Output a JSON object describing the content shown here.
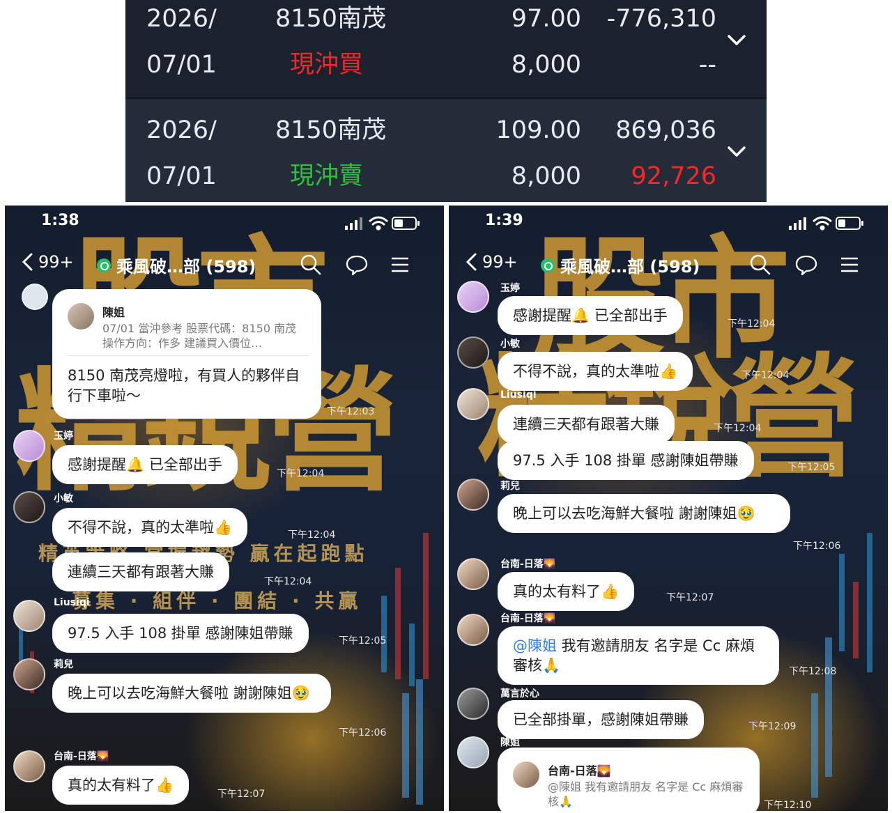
{
  "trades": [
    {
      "date_line1": "2026/",
      "date_line2": "07/01",
      "stock": "8150南茂",
      "action": "現沖買",
      "price": "97.00",
      "quantity": "8,000",
      "amount": "-776,310",
      "pl": "--"
    },
    {
      "date_line1": "2026/",
      "date_line2": "07/01",
      "stock": "8150南茂",
      "action": "現沖賣",
      "price": "109.00",
      "quantity": "8,000",
      "amount": "869,036",
      "pl": "92,726"
    }
  ],
  "colors": {
    "buy": "#ec2a2a",
    "sell": "#2fbf3c",
    "profit": "#ff2525",
    "panel_bg": "#1b222e"
  },
  "left_phone": {
    "status_time": "1:38",
    "back_count": "99+",
    "chat_title": "乘風破…部 (598)",
    "bg_title": "股市精銳營",
    "bg_motto_1": "精英策略  掌握趨勢  贏在起跑點",
    "bg_motto_2": "募集 · 組伴 · 團結 · 共贏",
    "reply_msg": {
      "quoted_name": "陳姐",
      "quoted_text": "07/01 當沖參考 股票代碼：8150 南茂 操作方向：作多 建議買入價位…",
      "body": "8150 南茂亮燈啦，有買人的夥伴自行下車啦～",
      "time": "下午12:03"
    },
    "messages": [
      {
        "sender": "玉婷",
        "text": "感謝提醒🔔 已全部出手",
        "time": "下午12:04"
      },
      {
        "sender": "小敏",
        "text": "不得不說，真的太準啦👍",
        "time": "下午12:04"
      },
      {
        "sender": "",
        "text": "連續三天都有跟著大賺",
        "time": "下午12:04"
      },
      {
        "sender": "Liusiqi",
        "text": "97.5 入手 108 掛單 感謝陳姐帶賺",
        "time": "下午12:05"
      },
      {
        "sender": "莉兒",
        "text": "晚上可以去吃海鮮大餐啦 謝謝陳姐🥹",
        "time": "下午12:06"
      },
      {
        "sender": "台南-日落🌄",
        "text": "真的太有料了👍",
        "time": "下午12:07"
      }
    ]
  },
  "right_phone": {
    "status_time": "1:39",
    "back_count": "99+",
    "chat_title": "乘風破…部 (598)",
    "messages": [
      {
        "sender": "玉婷",
        "text": "感謝提醒🔔 已全部出手",
        "time": "下午12:04"
      },
      {
        "sender": "小敏",
        "text": "不得不說，真的太準啦👍",
        "time": "下午12:04"
      },
      {
        "sender": "Liusiqi",
        "text": "連續三天都有跟著大賺",
        "time": "下午12:04"
      },
      {
        "sender": "",
        "text": "97.5 入手 108 掛單 感謝陳姐帶賺",
        "time": "下午12:05"
      },
      {
        "sender": "莉兒",
        "text": "晚上可以去吃海鮮大餐啦 謝謝陳姐🥹",
        "time": "下午12:06"
      },
      {
        "sender": "台南-日落🌄",
        "text": "真的太有料了👍",
        "time": "下午12:07"
      },
      {
        "sender": "台南-日落🌄",
        "mention": "@陳姐",
        "text": " 我有邀請朋友 名字是 Cc 麻煩審核🙏",
        "time": "下午12:08"
      },
      {
        "sender": "萬言於心",
        "text": "已全部掛單，感謝陳姐帶賺",
        "time": "下午12:09"
      }
    ],
    "last_reply": {
      "sender": "陳姐",
      "quoted_name": "台南-日落🌄",
      "quoted_text": "@陳姐 我有邀請朋友 名字是 Cc 麻煩審核🙏",
      "time": "下午12:10"
    }
  },
  "icons": [
    "chevron-down-icon",
    "signal-icon",
    "wifi-icon",
    "battery-icon",
    "back-chevron-icon",
    "chat-room-icon",
    "search-icon",
    "speech-bubble-icon",
    "menu-icon"
  ]
}
